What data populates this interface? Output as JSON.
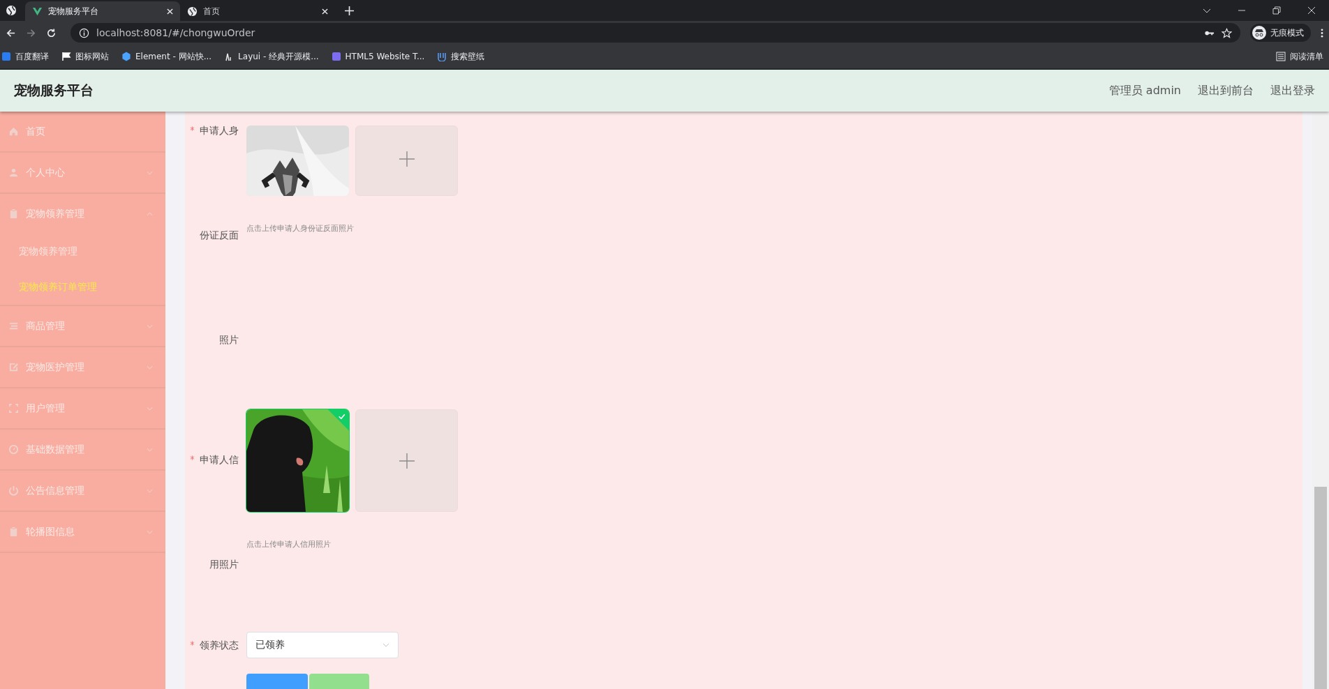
{
  "browser": {
    "tabs": [
      {
        "title": "宠物服务平台",
        "selected": true
      },
      {
        "title": "首页",
        "selected": false
      }
    ],
    "address": "localhost:8081/#/chongwuOrder",
    "profile": "无痕模式",
    "bookmarks": [
      "百度翻译",
      "图标网站",
      "Element - 网站快...",
      "Layui - 经典开源模...",
      "HTML5 Website T...",
      "搜索壁纸"
    ],
    "reading_list": "阅读清单"
  },
  "header": {
    "title": "宠物服务平台",
    "links": [
      "管理员 admin",
      "退出到前台",
      "退出登录"
    ]
  },
  "sidebar": {
    "items": [
      {
        "kind": "link",
        "label": "首页"
      },
      {
        "kind": "menu",
        "label": "个人中心",
        "expanded": false
      },
      {
        "kind": "menu",
        "label": "宠物领养管理",
        "expanded": true,
        "children": [
          {
            "label": "宠物领养管理",
            "selected": false
          },
          {
            "label": "宠物领养订单管理",
            "selected": true
          }
        ]
      },
      {
        "kind": "menu",
        "label": "商品管理",
        "expanded": false
      },
      {
        "kind": "menu",
        "label": "宠物医护管理",
        "expanded": false
      },
      {
        "kind": "menu",
        "label": "用户管理",
        "expanded": false
      },
      {
        "kind": "menu",
        "label": "基础数据管理",
        "expanded": false
      },
      {
        "kind": "menu",
        "label": "公告信息管理",
        "expanded": false
      },
      {
        "kind": "menu",
        "label": "轮播图信息",
        "expanded": false
      }
    ]
  },
  "form": {
    "fields": [
      {
        "kind": "upload",
        "label": "申请人身份证反面照片",
        "required": true,
        "hint": "点击上传申请人身份证反面照片",
        "image": {
          "kind": "picture",
          "success": false
        }
      },
      {
        "kind": "upload",
        "label": "申请人信用照片",
        "required": true,
        "hint": "点击上传申请人信用照片",
        "image": {
          "kind": "picture",
          "success": true
        }
      },
      {
        "kind": "select",
        "label": "领养状态",
        "required": true,
        "value": "已领养"
      }
    ],
    "buttons": [
      {
        "kind": "primary"
      },
      {
        "kind": "success"
      }
    ]
  }
}
